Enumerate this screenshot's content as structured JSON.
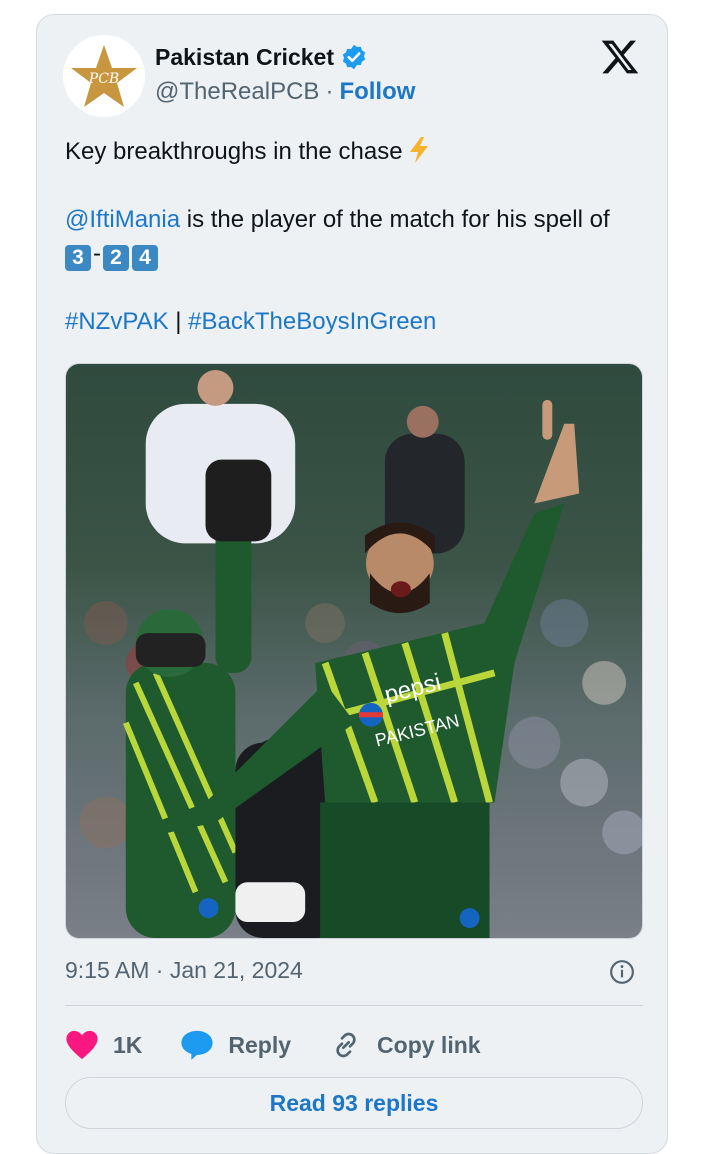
{
  "author": {
    "name": "Pakistan Cricket",
    "handle": "@TheRealPCB",
    "separator": "·",
    "follow_label": "Follow",
    "verified": true
  },
  "tweet": {
    "line1": "Key breakthroughs in the chase",
    "mention": "@IftiMania",
    "line2_rest": " is the player of the match for his spell of",
    "figures": [
      "3",
      "2",
      "4"
    ],
    "figures_dash": "-",
    "hashtag1": "#NZvPAK",
    "hashtag_sep": " | ",
    "hashtag2": "#BackTheBoysInGreen"
  },
  "media": {
    "jersey_text_1": "pepsi",
    "jersey_text_2": "PAKISTAN"
  },
  "meta": {
    "timestamp": "9:15 AM · Jan 21, 2024"
  },
  "actions": {
    "like_count": "1K",
    "reply_label": "Reply",
    "copy_label": "Copy link"
  },
  "read_replies_label": "Read 93 replies",
  "colors": {
    "link": "#1d77c7",
    "like_heart": "#f91880",
    "reply_bubble": "#1d9bf0",
    "card_bg": "#eef1f4"
  }
}
